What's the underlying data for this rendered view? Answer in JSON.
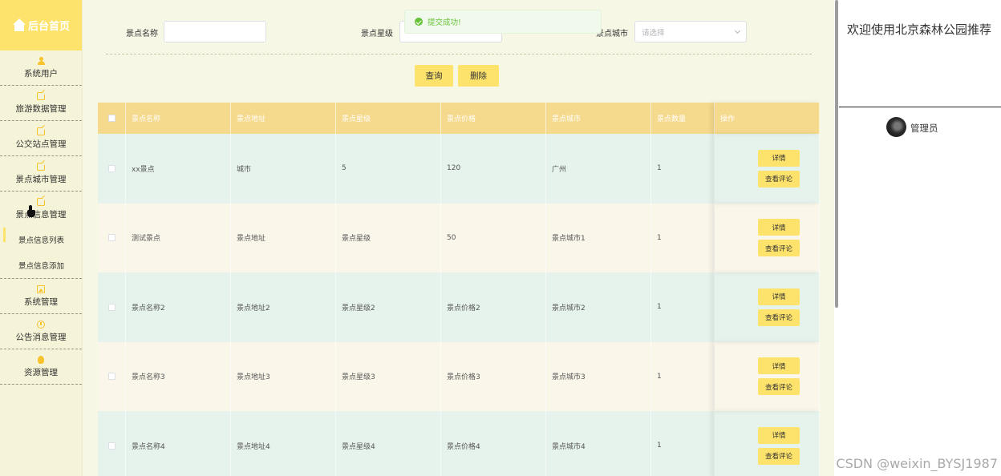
{
  "brand": {
    "title": "后台首页",
    "icon": "home-icon"
  },
  "sidebar": {
    "items": [
      {
        "label": "系统用户",
        "icon": "user-icon"
      },
      {
        "label": "旅游数据管理",
        "icon": "edit-icon"
      },
      {
        "label": "公交站点管理",
        "icon": "edit-icon"
      },
      {
        "label": "景点城市管理",
        "icon": "edit-icon"
      },
      {
        "label": "景点信息管理",
        "icon": "edit-icon"
      },
      {
        "label": "系统管理",
        "icon": "image-icon"
      },
      {
        "label": "公告消息管理",
        "icon": "info-icon"
      },
      {
        "label": "资源管理",
        "icon": "bulb-icon"
      }
    ],
    "subitems": [
      {
        "label": "景点信息列表",
        "active": true
      },
      {
        "label": "景点信息添加",
        "active": false
      }
    ]
  },
  "filter": {
    "name_label": "景点名称",
    "star_label": "景点星级",
    "city_label": "景点城市",
    "city_placeholder": "请选择",
    "name_value": "",
    "star_value": ""
  },
  "buttons": {
    "query": "查询",
    "delete": "删除"
  },
  "toast": {
    "message": "提交成功!"
  },
  "table": {
    "headers": [
      "景点名称",
      "景点地址",
      "景点星级",
      "景点价格",
      "景点城市",
      "景点数量",
      "操作"
    ],
    "rows": [
      [
        "xx景点",
        "城市",
        "5",
        "120",
        "广州",
        "1"
      ],
      [
        "测试景点",
        "景点地址",
        "景点星级",
        "50",
        "景点城市1",
        "1"
      ],
      [
        "景点名称2",
        "景点地址2",
        "景点星级2",
        "景点价格2",
        "景点城市2",
        "1"
      ],
      [
        "景点名称3",
        "景点地址3",
        "景点星级3",
        "景点价格3",
        "景点城市3",
        "1"
      ],
      [
        "景点名称4",
        "景点地址4",
        "景点星级4",
        "景点价格4",
        "景点城市4",
        "1"
      ]
    ],
    "row_buttons": {
      "detail": "详情",
      "comments": "查看评论"
    }
  },
  "right_panel": {
    "welcome": "欢迎使用北京森林公园推荐",
    "user": "管理员"
  },
  "watermark": "CSDN @weixin_BYSJ1987",
  "colors": {
    "accent": "#fde36c",
    "header": "#f5d98c",
    "sidebar_bg": "#f6f4d8",
    "main_bg": "#f7f7e6",
    "row_odd": "#e6f3ec",
    "row_even": "#faf6ea",
    "success": "#67c23a"
  }
}
